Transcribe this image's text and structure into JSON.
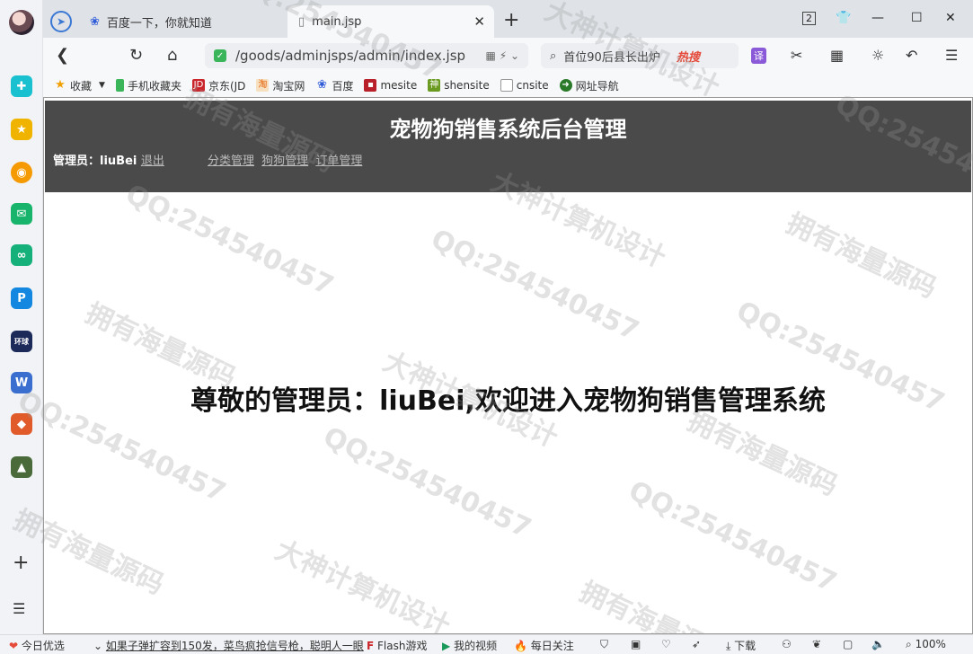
{
  "tabs": [
    {
      "label": "百度一下，你就知道"
    },
    {
      "label": "main.jsp"
    }
  ],
  "window": {
    "tab_count": "2"
  },
  "address": {
    "url": "/goods/adminjsps/admin/index.jsp"
  },
  "search": {
    "query": "首位90后县长出炉",
    "hot": "热搜",
    "translate": "译"
  },
  "bookmarks": [
    {
      "label": "收藏"
    },
    {
      "label": "手机收藏夹"
    },
    {
      "label": "京东(JD"
    },
    {
      "label": "淘宝网"
    },
    {
      "label": "百度"
    },
    {
      "label": "mesite"
    },
    {
      "label": "shensite"
    },
    {
      "label": "cnsite"
    },
    {
      "label": "网址导航"
    }
  ],
  "page": {
    "title": "宠物狗销售系统后台管理",
    "admin_label": "管理员：liuBei",
    "logout": "退出",
    "menu": [
      "分类管理",
      "狗狗管理",
      "订单管理"
    ],
    "welcome": "尊敬的管理员：liuBei,欢迎进入宠物狗销售管理系统"
  },
  "statusbar": {
    "daily": "今日优选",
    "news": "如果子弹扩容到150发，菜鸟疯抢信号枪，聪明人一眼",
    "flash": "Flash游戏",
    "video": "我的视频",
    "focus": "每日关注",
    "download": "下载",
    "zoom": "100%"
  },
  "watermark": {
    "qq": "QQ:254540457",
    "a": "大神计算机设计",
    "b": "拥有海量源码"
  },
  "colors": {
    "header_bg": "#4a4a4a",
    "tab_active": "#f7f8fa",
    "accent": "#3a78d4"
  }
}
